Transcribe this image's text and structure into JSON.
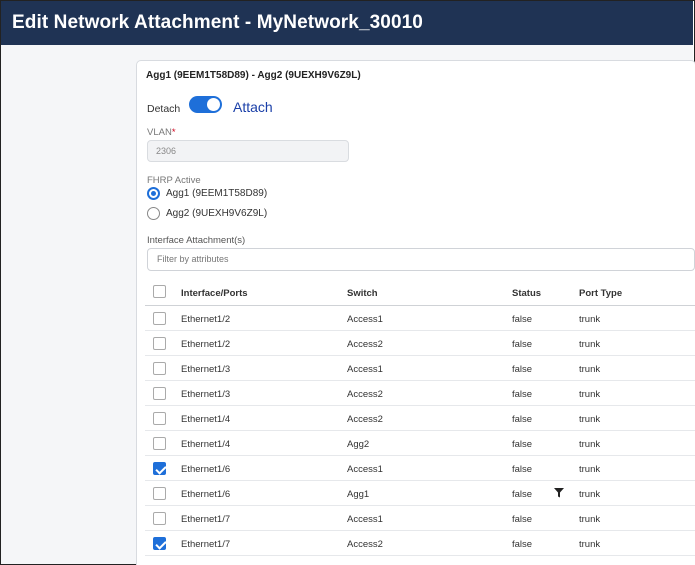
{
  "window": {
    "title": "Edit Network Attachment - MyNetwork_30010"
  },
  "attachment": {
    "heading": "Agg1 (9EEM1T58D89) - Agg2 (9UEXH9V6Z9L)",
    "detach_label": "Detach",
    "attach_label": "Attach",
    "toggle_state": "attach"
  },
  "vlan": {
    "label": "VLAN",
    "required_mark": "*",
    "value": "2306"
  },
  "fhrp": {
    "label": "FHRP Active",
    "options": [
      {
        "label": "Agg1 (9EEM1T58D89)",
        "selected": true
      },
      {
        "label": "Agg2 (9UEXH9V6Z9L)",
        "selected": false
      }
    ]
  },
  "interfaces": {
    "label": "Interface Attachment(s)",
    "filter_placeholder": "Filter by attributes",
    "columns": [
      "Interface/Ports",
      "Switch",
      "Status",
      "Port Type"
    ],
    "rows": [
      {
        "iface": "Ethernet1/2",
        "switch": "Access1",
        "status": "false",
        "port_type": "trunk",
        "checked": false
      },
      {
        "iface": "Ethernet1/2",
        "switch": "Access2",
        "status": "false",
        "port_type": "trunk",
        "checked": false
      },
      {
        "iface": "Ethernet1/3",
        "switch": "Access1",
        "status": "false",
        "port_type": "trunk",
        "checked": false
      },
      {
        "iface": "Ethernet1/3",
        "switch": "Access2",
        "status": "false",
        "port_type": "trunk",
        "checked": false
      },
      {
        "iface": "Ethernet1/4",
        "switch": "Access2",
        "status": "false",
        "port_type": "trunk",
        "checked": false
      },
      {
        "iface": "Ethernet1/4",
        "switch": "Agg2",
        "status": "false",
        "port_type": "trunk",
        "checked": false
      },
      {
        "iface": "Ethernet1/6",
        "switch": "Access1",
        "status": "false",
        "port_type": "trunk",
        "checked": true
      },
      {
        "iface": "Ethernet1/6",
        "switch": "Agg1",
        "status": "false",
        "port_type": "trunk",
        "checked": false,
        "filter_icon": "filter-icon"
      },
      {
        "iface": "Ethernet1/7",
        "switch": "Access1",
        "status": "false",
        "port_type": "trunk",
        "checked": false
      },
      {
        "iface": "Ethernet1/7",
        "switch": "Access2",
        "status": "false",
        "port_type": "trunk",
        "checked": true
      }
    ]
  },
  "colors": {
    "titlebar": "#1f3354",
    "accent": "#1e6fd9",
    "attach_text": "#1a3fa8"
  }
}
